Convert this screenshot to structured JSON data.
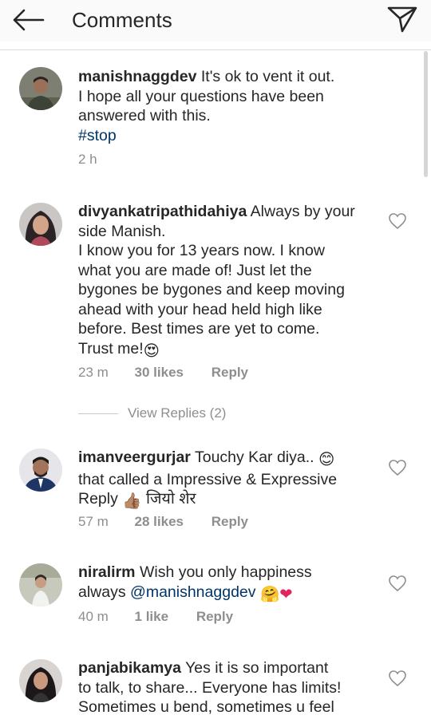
{
  "header": {
    "title": "Comments"
  },
  "comments": [
    {
      "username": "manishnaggdev",
      "lines": [
        "It's ok to vent it out.",
        "I hope all your questions have been",
        "answered with this."
      ],
      "hashtag": "#stop",
      "time": "2 h"
    },
    {
      "username": "divyankatripathidahiya",
      "lines": [
        "Always by your",
        "side Manish.",
        "I know you for 13 years now. I know",
        "what you are made of! Just let the",
        "bygones be bygones and keep moving",
        "ahead with your head held high like",
        "before. Best times are yet to come.",
        "Trust me!"
      ],
      "emoji": "😍",
      "time": "23 m",
      "likes": "30 likes",
      "reply": "Reply",
      "view_replies": "View Replies (2)"
    },
    {
      "username": "imanveergurjar",
      "lines": [
        "Touchy Kar diya..",
        "that called a Impressive & Expressive",
        "Reply"
      ],
      "emoji1": "😊",
      "emoji2": "👍🏽",
      "hindi": "जियो शेर",
      "time": "57 m",
      "likes": "28 likes",
      "reply": "Reply"
    },
    {
      "username": "niralirm",
      "lines": [
        "Wish you only happiness",
        "always"
      ],
      "mention": "@manishnaggdev",
      "emoji1": "🤗",
      "emoji2": "❤",
      "time": "40 m",
      "likes": "1 like",
      "reply": "Reply"
    },
    {
      "username": "panjabikamya",
      "lines": [
        "Yes it is so important",
        "to talk, to share... Everyone has limits!",
        "Sometimes u bend, sometimes u feel"
      ]
    }
  ]
}
